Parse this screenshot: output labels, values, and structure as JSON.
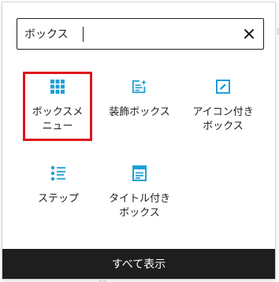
{
  "search": {
    "value": "ボックス"
  },
  "blocks": [
    {
      "label_lines": [
        "ボックスメ",
        "ニュー"
      ],
      "icon": "grid-icon",
      "selected": true
    },
    {
      "label_lines": [
        "装飾ボックス"
      ],
      "icon": "text-box-sparkle-icon",
      "selected": false
    },
    {
      "label_lines": [
        "アイコン付き",
        "ボックス"
      ],
      "icon": "pencil-box-icon",
      "selected": false
    },
    {
      "label_lines": [
        "ステップ"
      ],
      "icon": "step-list-icon",
      "selected": false
    },
    {
      "label_lines": [
        "タイトル付き",
        "ボックス"
      ],
      "icon": "titled-document-icon",
      "selected": false
    }
  ],
  "footer": {
    "show_all_label": "すべて表示"
  },
  "colors": {
    "icon_accent": "#1e9fd4",
    "selected_border": "#e0141b",
    "footer_bg": "#1e1e1e"
  }
}
